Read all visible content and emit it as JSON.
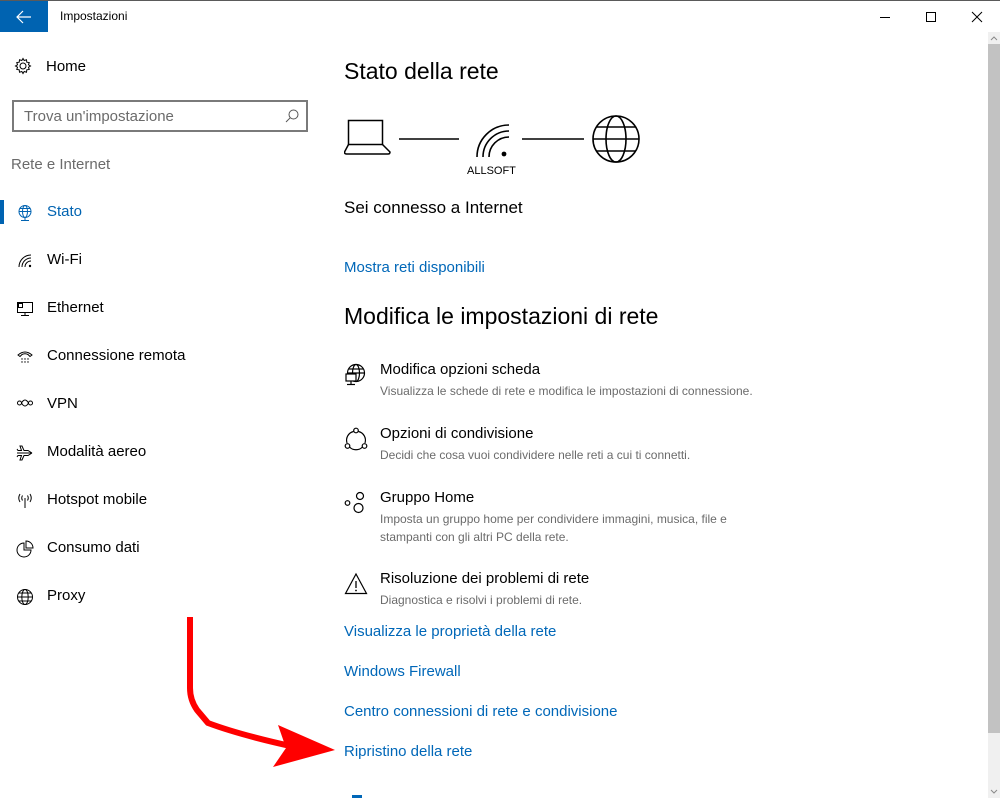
{
  "window": {
    "title": "Impostazioni",
    "back_icon": "arrow-left-icon",
    "controls": [
      "minimize",
      "maximize",
      "close"
    ]
  },
  "sidebar": {
    "home_label": "Home",
    "search_placeholder": "Trova un'impostazione",
    "search_value": "",
    "section_label": "Rete e Internet",
    "items": [
      {
        "label": "Stato",
        "icon": "network-status-icon",
        "active": true
      },
      {
        "label": "Wi-Fi",
        "icon": "wifi-icon",
        "active": false
      },
      {
        "label": "Ethernet",
        "icon": "ethernet-icon",
        "active": false
      },
      {
        "label": "Connessione remota",
        "icon": "dialup-phone-icon",
        "active": false
      },
      {
        "label": "VPN",
        "icon": "vpn-icon",
        "active": false
      },
      {
        "label": "Modalità aereo",
        "icon": "airplane-icon",
        "active": false
      },
      {
        "label": "Hotspot mobile",
        "icon": "hotspot-icon",
        "active": false
      },
      {
        "label": "Consumo dati",
        "icon": "data-usage-icon",
        "active": false
      },
      {
        "label": "Proxy",
        "icon": "globe-icon",
        "active": false
      }
    ]
  },
  "main": {
    "status_title": "Stato della rete",
    "network_name": "ALLSOFT",
    "connection_status": "Sei connesso a Internet",
    "show_networks_link": "Mostra reti disponibili",
    "change_title": "Modifica le impostazioni di rete",
    "options": [
      {
        "title": "Modifica opzioni scheda",
        "desc": "Visualizza le schede di rete e modifica le impostazioni di connessione.",
        "icon": "adapter-icon"
      },
      {
        "title": "Opzioni di condivisione",
        "desc": "Decidi che cosa vuoi condividere nelle reti a cui ti connetti.",
        "icon": "sharing-icon"
      },
      {
        "title": "Gruppo Home",
        "desc": "Imposta un gruppo home per condividere immagini, musica, file e stampanti con gli altri PC della rete.",
        "icon": "homegroup-icon"
      },
      {
        "title": "Risoluzione dei problemi di rete",
        "desc": "Diagnostica e risolvi i problemi di rete.",
        "icon": "warning-icon"
      }
    ],
    "links": [
      "Visualizza le proprietà della rete",
      "Windows Firewall",
      "Centro connessioni di rete e condivisione",
      "Ripristino della rete"
    ]
  },
  "colors": {
    "accent": "#0063b1",
    "link": "#0067b8",
    "annotation_arrow": "#ff0000"
  }
}
